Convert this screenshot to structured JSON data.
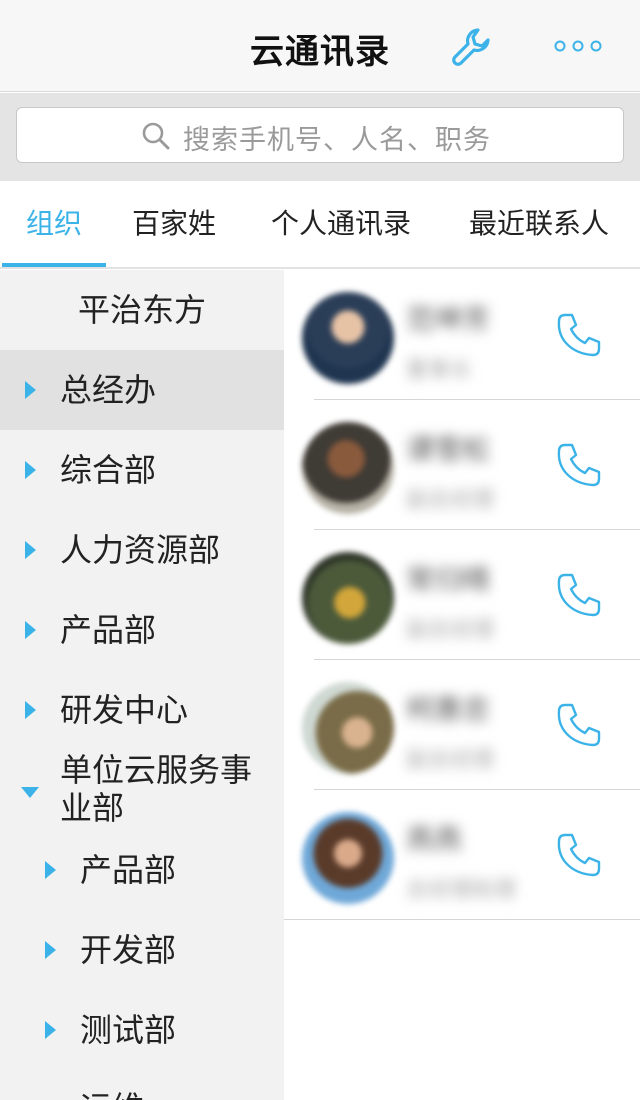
{
  "header": {
    "title": "云通讯录",
    "settings_icon": "wrench-icon",
    "more_icon": "more-dots-icon"
  },
  "search": {
    "placeholder": "搜索手机号、人名、职务"
  },
  "tabs": [
    {
      "label": "组织",
      "active": true
    },
    {
      "label": "百家姓",
      "active": false
    },
    {
      "label": "个人通讯录",
      "active": false
    },
    {
      "label": "最近联系人",
      "active": false
    }
  ],
  "org": {
    "title": "平治东方",
    "departments": [
      {
        "label": "总经办",
        "expanded": false,
        "selected": true
      },
      {
        "label": "综合部",
        "expanded": false
      },
      {
        "label": "人力资源部",
        "expanded": false
      },
      {
        "label": "产品部",
        "expanded": false
      },
      {
        "label": "研发中心",
        "expanded": false
      },
      {
        "label": "单位云服务事业部",
        "label_line1": "单位云服务事",
        "label_line2": "业部",
        "expanded": true
      },
      {
        "label": "产品部",
        "expanded": false,
        "level": 2
      },
      {
        "label": "开发部",
        "expanded": false,
        "level": 2
      },
      {
        "label": "测试部",
        "expanded": false,
        "level": 2
      },
      {
        "label": "运维",
        "expanded": false,
        "level": 2
      }
    ]
  },
  "contacts": [
    {
      "name": "范坤芳",
      "role": "董事长"
    },
    {
      "name": "谭雪松",
      "role": "副总经理"
    },
    {
      "name": "常归晴",
      "role": "副总经理"
    },
    {
      "name": "柯惠忠",
      "role": "副总经理"
    },
    {
      "name": "燕燕",
      "role": "总经理助理"
    }
  ],
  "colors": {
    "accent": "#3cb3e8",
    "header_bg": "#f7f7f7",
    "left_panel_bg": "#f2f2f2",
    "selected_row_bg": "#e1e1e1"
  }
}
